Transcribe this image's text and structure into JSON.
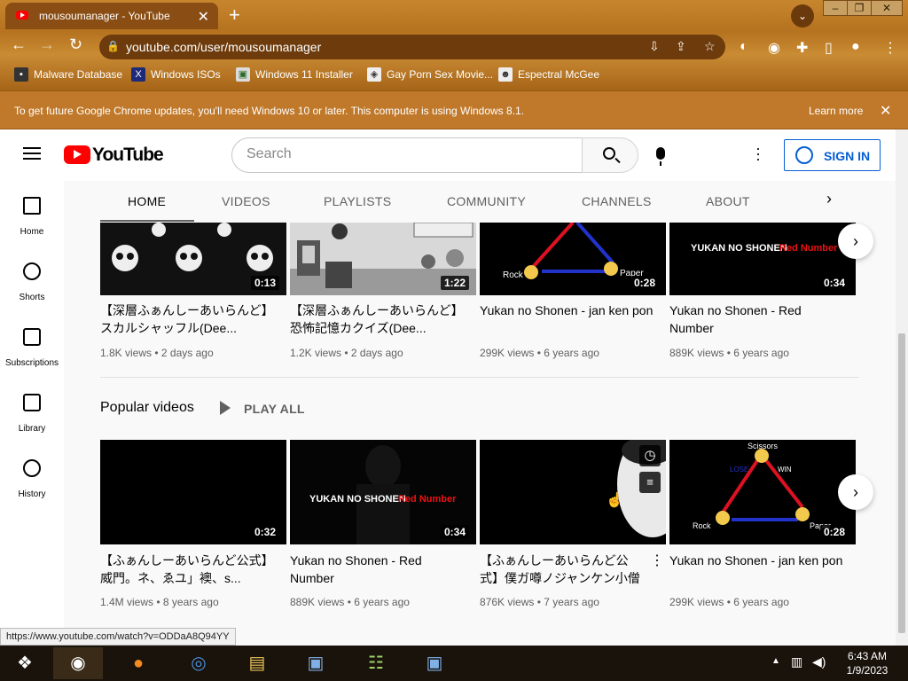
{
  "browser": {
    "tab_title": "mousoumanager - YouTube",
    "url": "youtube.com/user/mousoumanager",
    "bookmarks": [
      {
        "label": "Malware Database",
        "icon": "bookmark-folder-icon"
      },
      {
        "label": "Windows ISOs",
        "icon": "x-logo-icon"
      },
      {
        "label": "Windows 11 Installer",
        "icon": "image-icon"
      },
      {
        "label": "Gay Porn Sex Movie...",
        "icon": "page-icon"
      },
      {
        "label": "Espectral McGee",
        "icon": "page-icon"
      }
    ],
    "infobar": {
      "message": "To get future Google Chrome updates, you'll need Windows 10 or later. This computer is using Windows 8.1.",
      "learn_more": "Learn more"
    }
  },
  "youtube": {
    "logo_text": "YouTube",
    "search_placeholder": "Search",
    "sign_in": "SIGN IN",
    "sidenav": [
      {
        "label": "Home",
        "icon": "home-icon"
      },
      {
        "label": "Shorts",
        "icon": "shorts-icon"
      },
      {
        "label": "Subscriptions",
        "icon": "subscriptions-icon"
      },
      {
        "label": "Library",
        "icon": "library-icon"
      },
      {
        "label": "History",
        "icon": "history-icon"
      }
    ],
    "channel_tabs": [
      "HOME",
      "VIDEOS",
      "PLAYLISTS",
      "COMMUNITY",
      "CHANNELS",
      "ABOUT"
    ],
    "shelf_top": [
      {
        "title": "【深層ふぁんしーあいらんど】スカルシャッフル(Dee...",
        "views": "1.8K views",
        "age": "2 days ago",
        "duration": "0:13"
      },
      {
        "title": "【深層ふぁんしーあいらんど】恐怖記憶カクイズ(Dee...",
        "views": "1.2K views",
        "age": "2 days ago",
        "duration": "1:22"
      },
      {
        "title": "Yukan no Shonen - jan ken pon",
        "views": "299K views",
        "age": "6 years ago",
        "duration": "0:28"
      },
      {
        "title": "Yukan no Shonen - Red Number",
        "views": "889K views",
        "age": "6 years ago",
        "duration": "0:34"
      }
    ],
    "popular": {
      "title": "Popular videos",
      "play_all": "PLAY ALL",
      "videos": [
        {
          "title": "【ふぁんしーあいらんど公式】威門。ネ、ゑユ」襖、s...",
          "views": "1.4M views",
          "age": "8 years ago",
          "duration": "0:32"
        },
        {
          "title": "Yukan no Shonen - Red Number",
          "views": "889K views",
          "age": "6 years ago",
          "duration": "0:34"
        },
        {
          "title": "【ふぁんしーあいらんど公式】僕ガ噂ノジャンケン小僧",
          "views": "876K views",
          "age": "7 years ago",
          "duration": ""
        },
        {
          "title": "Yukan no Shonen - jan ken pon",
          "views": "299K views",
          "age": "6 years ago",
          "duration": "0:28"
        }
      ]
    },
    "thumb_text": {
      "red_number_white": "YUKAN NO SHONEN",
      "red_number_red": "Red Number",
      "rock": "Rock",
      "paper": "Paper",
      "scissors": "Scissors",
      "win": "WIN",
      "lose": "LOSE"
    }
  },
  "status_url": "https://www.youtube.com/watch?v=ODDaA8Q94YY",
  "taskbar": {
    "time": "6:43 AM",
    "date": "1/9/2023"
  }
}
